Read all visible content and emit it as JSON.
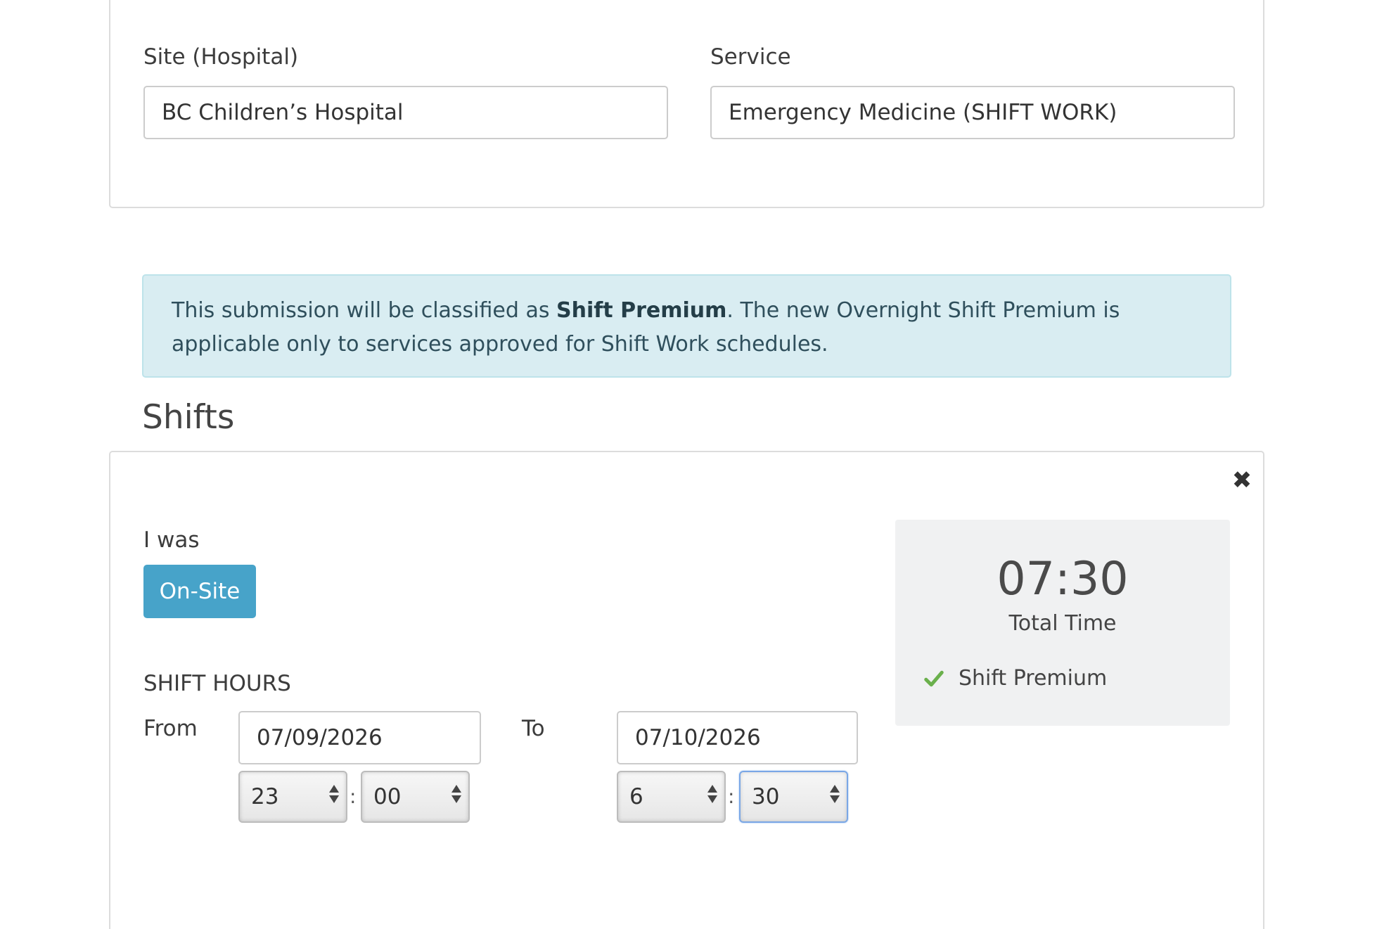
{
  "top_card": {
    "site_label": "Site (Hospital)",
    "site_value": "BC Children’s Hospital",
    "service_label": "Service",
    "service_value": "Emergency Medicine (SHIFT WORK)"
  },
  "alert": {
    "text_before": "This submission will be classified as ",
    "text_bold": "Shift Premium",
    "text_after": ". The new Overnight Shift Premium is applicable only to services approved for Shift Work schedules."
  },
  "shifts": {
    "title": "Shifts",
    "close_symbol": "✖",
    "i_was_label": "I was",
    "onsite_button": "On-Site",
    "shift_hours_label": "SHIFT HOURS",
    "from_label": "From",
    "to_label": "To",
    "from_date": "07/09/2026",
    "to_date": "07/10/2026",
    "from_hour": "23",
    "from_minute": "00",
    "to_hour": "6",
    "to_minute": "30",
    "time_separator": ":",
    "summary": {
      "total_time": "07:30",
      "total_time_label": "Total Time",
      "premium_label": "Shift Premium"
    }
  },
  "colors": {
    "accent_button": "#47a3c9",
    "alert_bg": "#d9edf2",
    "check_green": "#6ab04c"
  }
}
